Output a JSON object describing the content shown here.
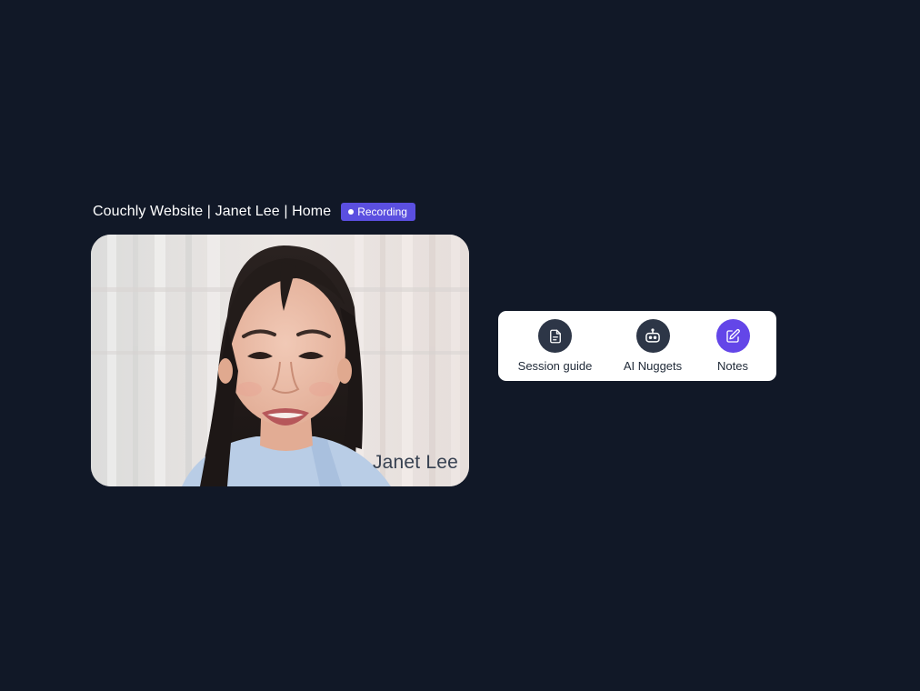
{
  "session": {
    "title": "Couchly Website | Janet Lee | Home",
    "recording_label": "Recording",
    "colors": {
      "background": "#111827",
      "recording_badge": "#5b4fe0",
      "active_tool": "#6346e8",
      "tool_icon_bg": "#2d3647"
    }
  },
  "video": {
    "participant_name": "Janet Lee"
  },
  "tools": {
    "session_guide": {
      "label": "Session guide",
      "icon": "document-icon"
    },
    "ai_nuggets": {
      "label": "AI Nuggets",
      "icon": "robot-icon"
    },
    "notes": {
      "label": "Notes",
      "icon": "edit-note-icon",
      "active": true
    }
  }
}
